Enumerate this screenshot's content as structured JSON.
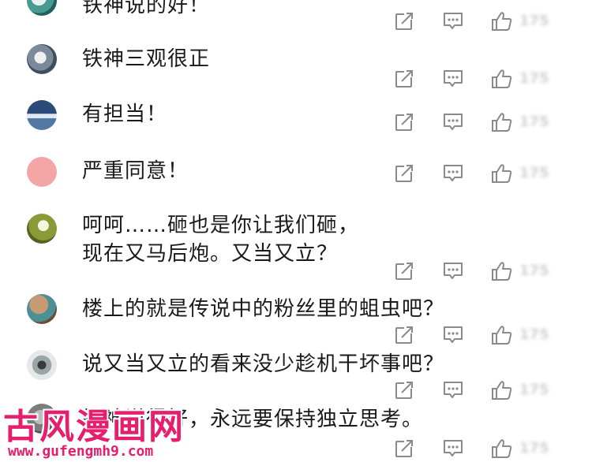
{
  "colors": {
    "icon": "#8a8a8a",
    "watermark": "#e61e6e",
    "count": "#d0d0d0"
  },
  "comments": [
    {
      "text": "铁神说的好！",
      "likes": "175",
      "avatar": "avatar-teal-character"
    },
    {
      "text": "铁神三观很正",
      "likes": "175",
      "avatar": "avatar-grey-character"
    },
    {
      "text": "有担当！",
      "likes": "175",
      "avatar": "avatar-blue-night"
    },
    {
      "text": "严重同意！",
      "likes": "175",
      "avatar": "avatar-pink-blank"
    },
    {
      "text_line1": "呵呵……砸也是你让我们砸，",
      "text_line2": "现在又马后炮。又当又立？",
      "likes": "175",
      "avatar": "avatar-olive-leaf"
    },
    {
      "text": "楼上的就是传说中的粉丝里的蛆虫吧？",
      "likes": "175",
      "avatar": "avatar-brown-teal"
    },
    {
      "text": "说又当又立的看来没少趁机干坏事吧？",
      "likes": "175",
      "avatar": "avatar-phone"
    },
    {
      "text": "铁神说得好，永远要保持独立思考。",
      "likes": "175",
      "avatar": "avatar-grey-photo"
    }
  ],
  "watermark": {
    "title": "古风漫画网",
    "url": "www.gufengmh9.com"
  },
  "icons": {
    "share": "share-icon",
    "reply": "reply-icon",
    "like": "thumbs-up-icon"
  }
}
